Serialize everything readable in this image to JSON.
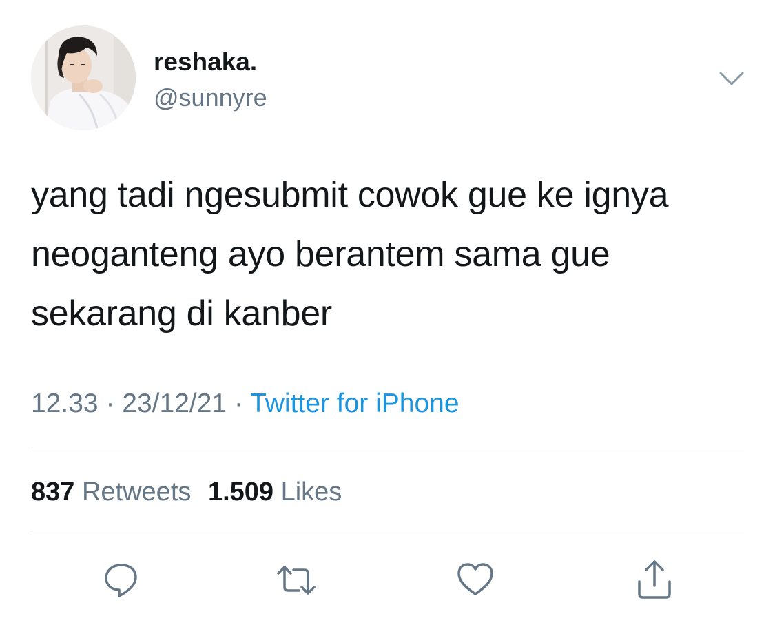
{
  "user": {
    "display_name": "reshaka.",
    "handle": "@sunnyre"
  },
  "tweet": {
    "text": "yang tadi ngesubmit cowok gue ke ignya neoganteng ayo berantem sama gue sekarang di kanber",
    "time": "12.33",
    "separator": "·",
    "date": "23/12/21",
    "source": "Twitter for iPhone"
  },
  "stats": {
    "retweets_count": "837",
    "retweets_label": "Retweets",
    "likes_count": "1.509",
    "likes_label": "Likes"
  },
  "actions": {
    "icons": [
      "reply-icon",
      "retweet-icon",
      "like-icon",
      "share-icon"
    ]
  },
  "colors": {
    "text": "#14171a",
    "secondary": "#657786",
    "link": "#1b95e0",
    "divider": "#d6dbdf",
    "icon": "#657786"
  }
}
